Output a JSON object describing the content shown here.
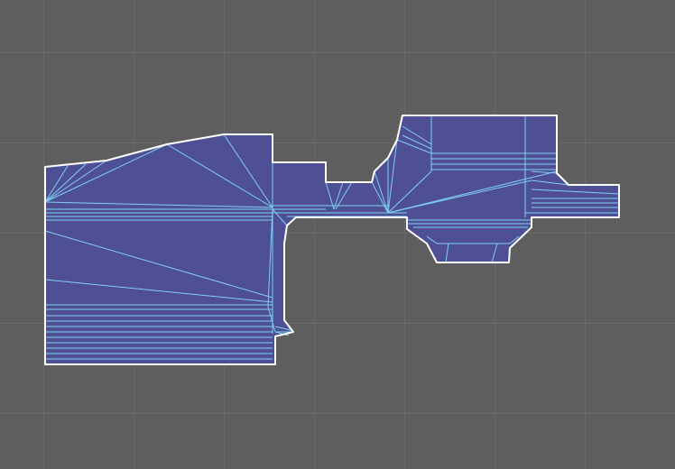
{
  "viewport": {
    "background_color": "#5e5e5e",
    "grid_color": "#6a6a6a"
  },
  "mesh": {
    "fill_color": "#4f4f96",
    "outline_color": "#ffffff",
    "triangle_edge_color": "#7fd0f0",
    "outline_visible": true,
    "wireframe_visible": true
  }
}
